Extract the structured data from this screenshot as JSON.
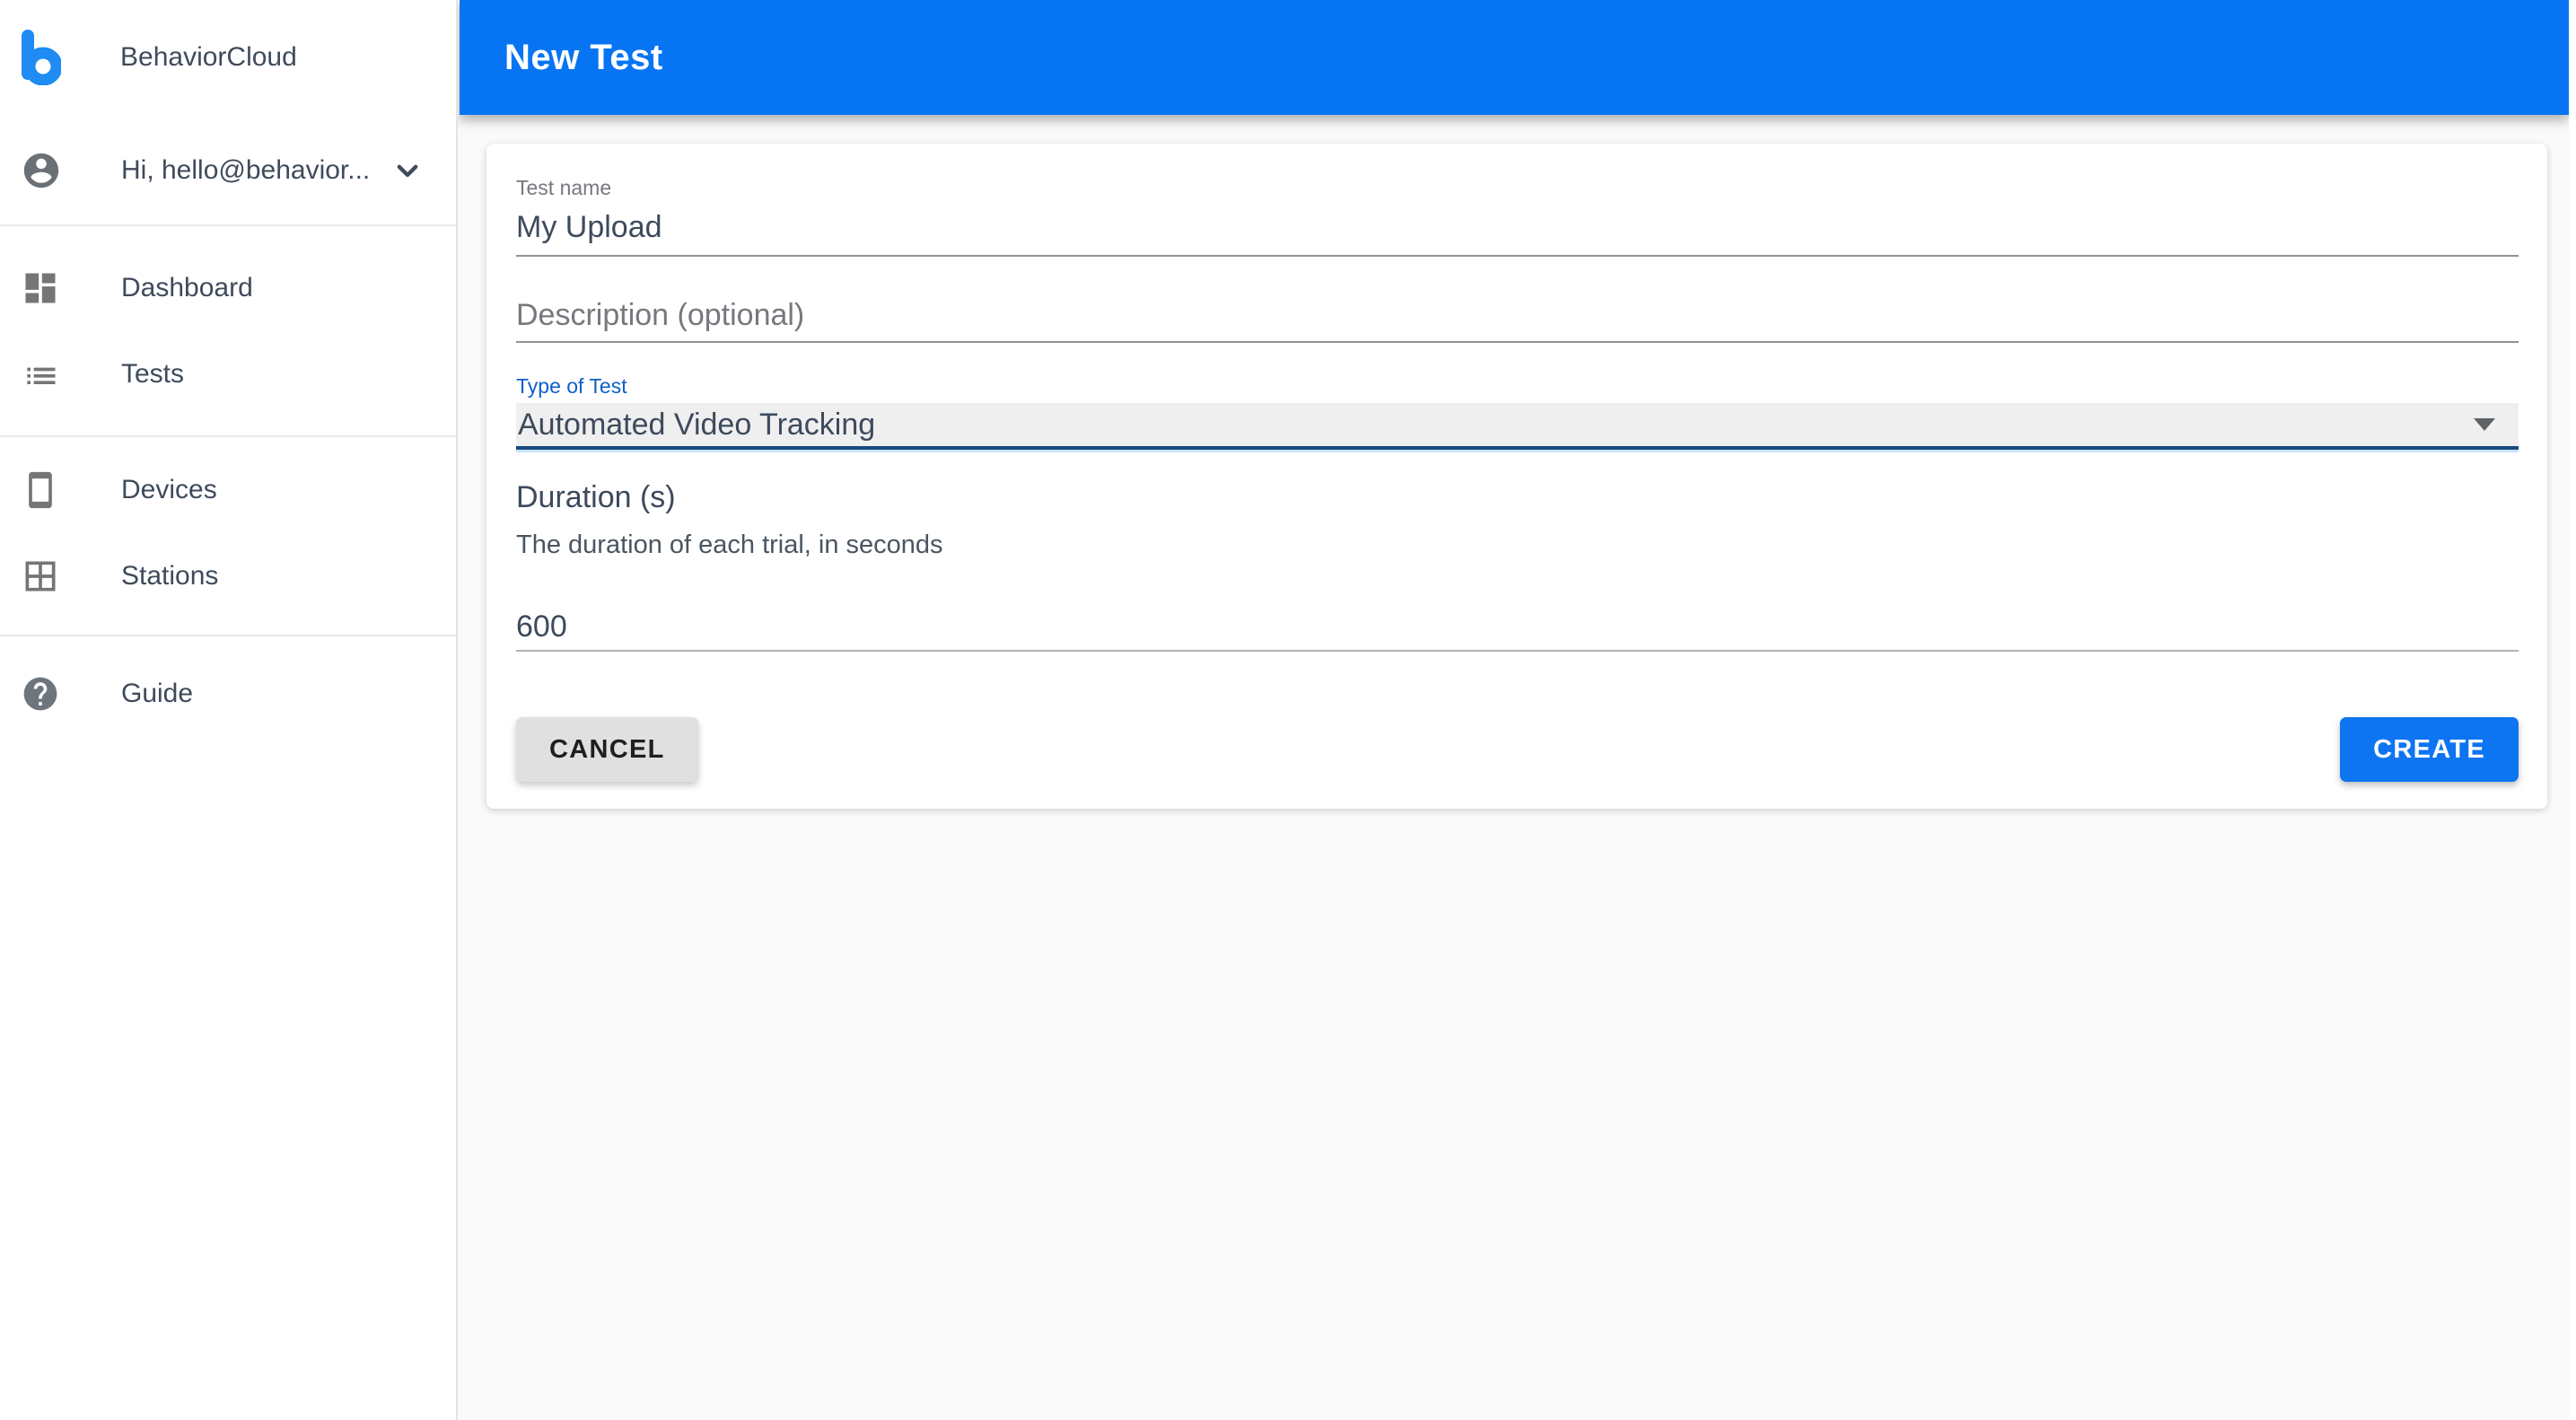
{
  "app": {
    "name": "BehaviorCloud"
  },
  "colors": {
    "header_blue": "#0775f3",
    "create_button_blue": "#0d74f2",
    "type_label_blue": "#1060c8",
    "select_underline_navy": "#174a7c",
    "sidebar_text": "#3f4b5b",
    "input_text": "#3d4a5c",
    "label_gray": "#75797e",
    "page_background": "#fafafa"
  },
  "sidebar": {
    "brand": "BehaviorCloud",
    "user": {
      "greeting": "Hi, hello@behavior..."
    },
    "items": [
      {
        "label": "Dashboard",
        "icon": "dashboard-icon"
      },
      {
        "label": "Tests",
        "icon": "list-icon"
      },
      {
        "label": "Devices",
        "icon": "smartphone-icon"
      },
      {
        "label": "Stations",
        "icon": "grid-icon"
      },
      {
        "label": "Guide",
        "icon": "help-icon"
      }
    ]
  },
  "header": {
    "title": "New Test"
  },
  "form": {
    "test_name": {
      "label": "Test name",
      "value": "My Upload"
    },
    "description": {
      "placeholder": "Description (optional)",
      "value": ""
    },
    "type_of_test": {
      "label": "Type of Test",
      "selected": "Automated Video Tracking"
    },
    "duration": {
      "label": "Duration (s)",
      "help": "The duration of each trial, in seconds",
      "value": "600"
    },
    "actions": {
      "cancel": "CANCEL",
      "create": "CREATE"
    }
  }
}
